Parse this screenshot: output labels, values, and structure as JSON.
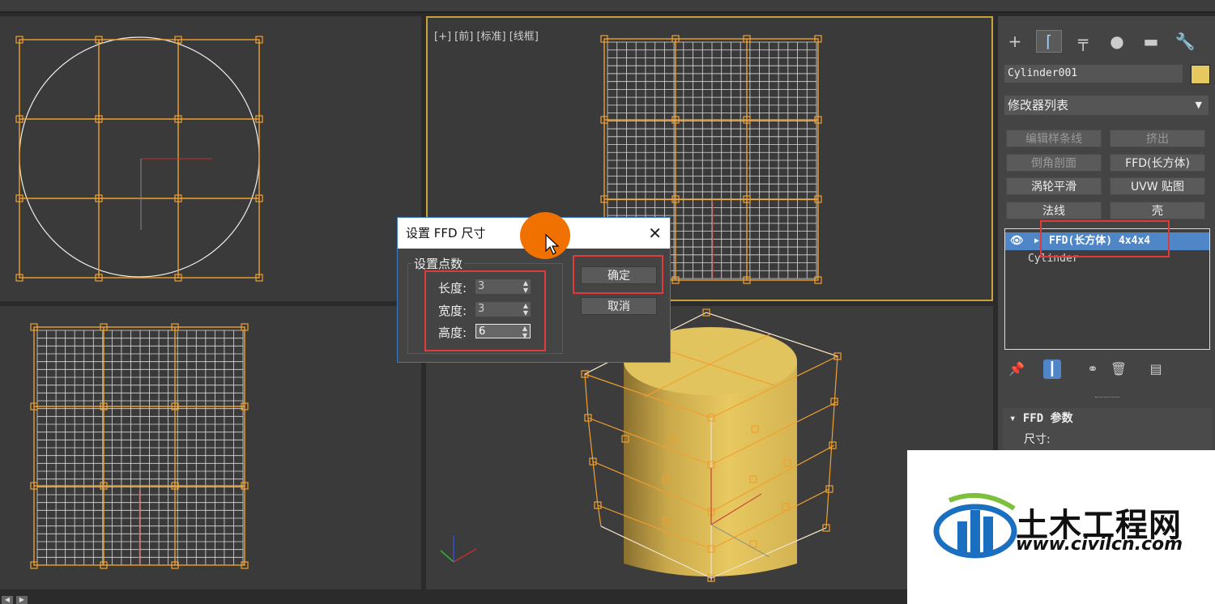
{
  "viewport_label": "[+] [前] [标准] [线框]",
  "command_tabs": [
    {
      "icon": "create-icon",
      "glyph": "+"
    },
    {
      "icon": "modify-icon",
      "glyph": "⌈"
    },
    {
      "icon": "hierarchy-icon",
      "glyph": "╤"
    },
    {
      "icon": "motion-icon",
      "glyph": "●"
    },
    {
      "icon": "display-icon",
      "glyph": "▬"
    },
    {
      "icon": "utilities-icon",
      "glyph": "🔧"
    }
  ],
  "object_name": "Cylinder001",
  "object_color": "#e6c860",
  "modifier_list_label": "修改器列表",
  "modifier_buttons": [
    {
      "label": "编辑样条线",
      "enabled": false
    },
    {
      "label": "挤出",
      "enabled": false
    },
    {
      "label": "倒角剖面",
      "enabled": false
    },
    {
      "label": "FFD(长方体)",
      "enabled": true
    },
    {
      "label": "涡轮平滑",
      "enabled": true
    },
    {
      "label": "UVW 贴图",
      "enabled": true
    },
    {
      "label": "法线",
      "enabled": true
    },
    {
      "label": "壳",
      "enabled": true
    }
  ],
  "stack": {
    "selected": "FFD(长方体) 4x4x4",
    "base": "Cylinder"
  },
  "rollout": {
    "title": "FFD 参数",
    "subtitle": "尺寸:"
  },
  "dialog": {
    "title": "设置 FFD 尺寸",
    "group_title": "设置点数",
    "length_label": "长度:",
    "length_value": "3",
    "width_label": "宽度:",
    "width_value": "3",
    "height_label": "高度:",
    "height_value": "6",
    "ok_label": "确定",
    "cancel_label": "取消"
  },
  "watermark": {
    "name": "土木工程网",
    "url": "www.civilcn.com"
  },
  "colors": {
    "accent_blue": "#4e86c8",
    "highlight_red": "#e03a3a",
    "lattice_orange": "#f0a030",
    "viewport_border": "#c8a23c"
  }
}
